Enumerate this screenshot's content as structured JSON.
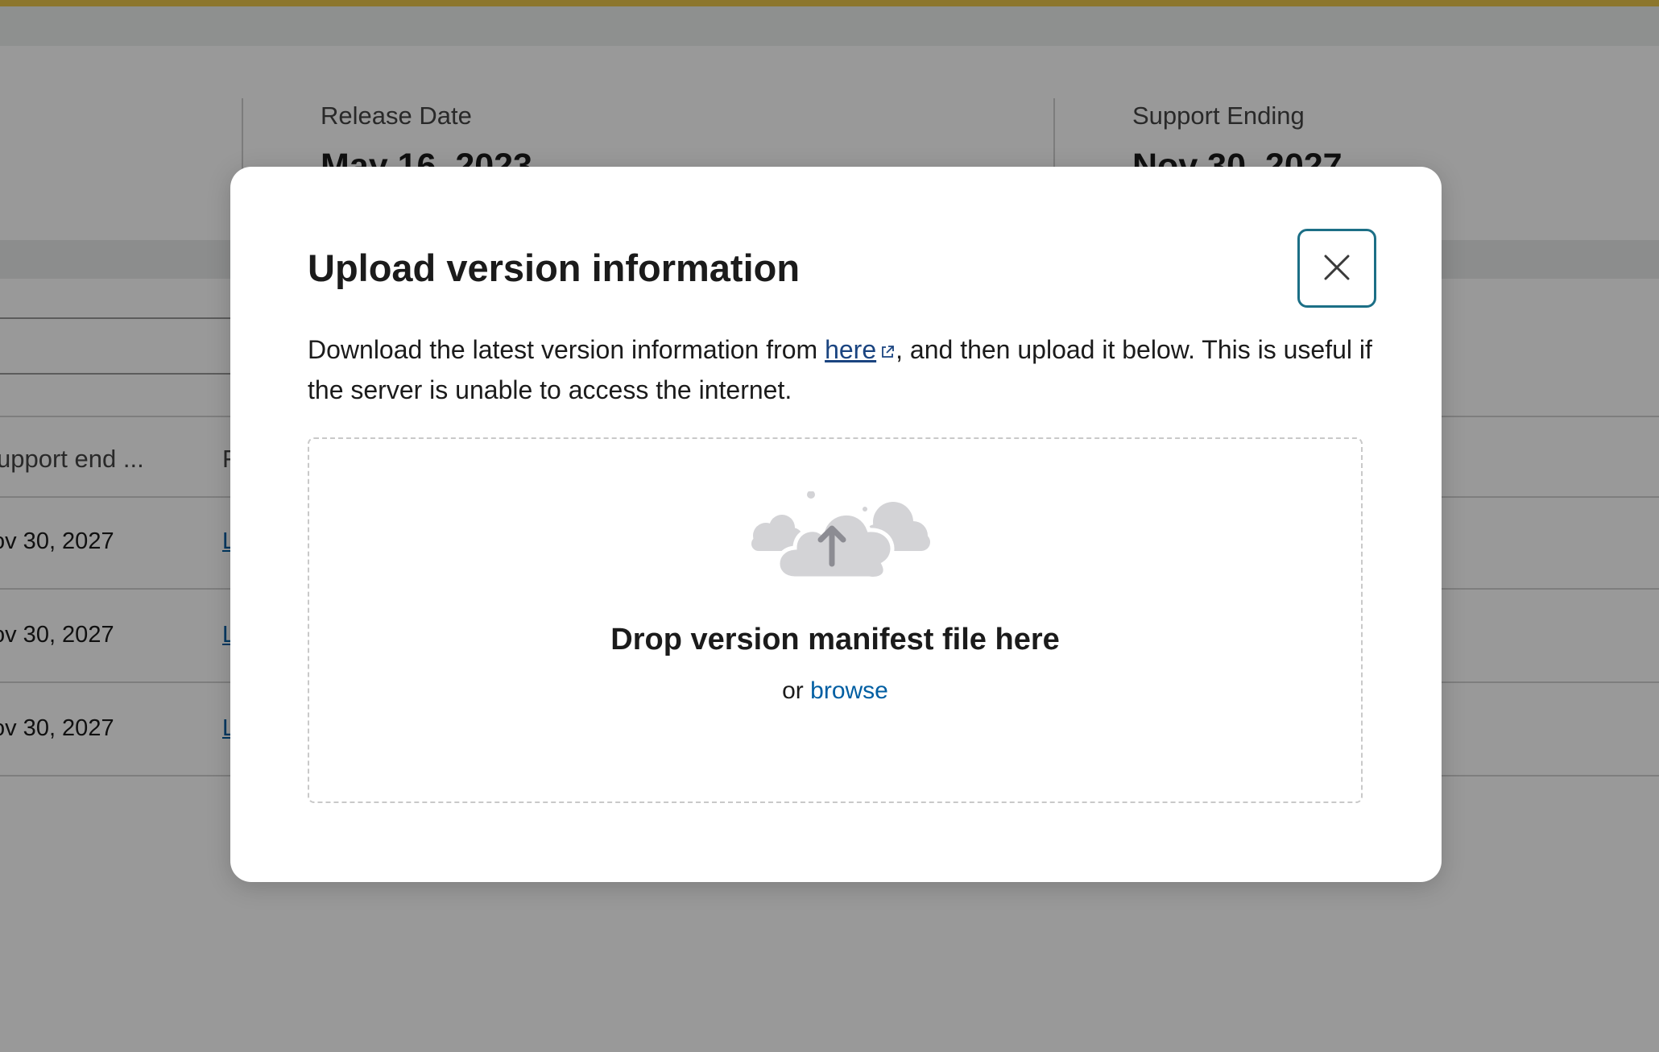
{
  "background": {
    "summary": [
      {
        "label": "Release Date",
        "value": "May 16, 2023"
      },
      {
        "label": "Support Ending",
        "value": "Nov 30, 2027"
      }
    ],
    "table": {
      "header_support": "upport end ...",
      "header_next": "F",
      "rows": [
        {
          "date": "ov 30, 2027",
          "link": "L"
        },
        {
          "date": "ov 30, 2027",
          "link": "L"
        },
        {
          "date": "ov 30, 2027",
          "link": "L"
        }
      ]
    }
  },
  "modal": {
    "title": "Upload version information",
    "close_icon": "close-icon",
    "description": {
      "before_link": "Download the latest version information from ",
      "link_text": "here",
      "link_icon": "external-link-icon",
      "after_link": ", and then upload it below. This is useful if the server is unable to access the internet."
    },
    "dropzone": {
      "icon": "cloud-upload-icon",
      "title": "Drop version manifest file here",
      "or_text": "or ",
      "browse_label": "browse"
    }
  },
  "colors": {
    "accent_border": "#1c6f86",
    "link": "#1a4480",
    "browse": "#005ea2",
    "overlay": "rgba(0,0,0,0.40)",
    "top_line": "#e9c54a"
  }
}
